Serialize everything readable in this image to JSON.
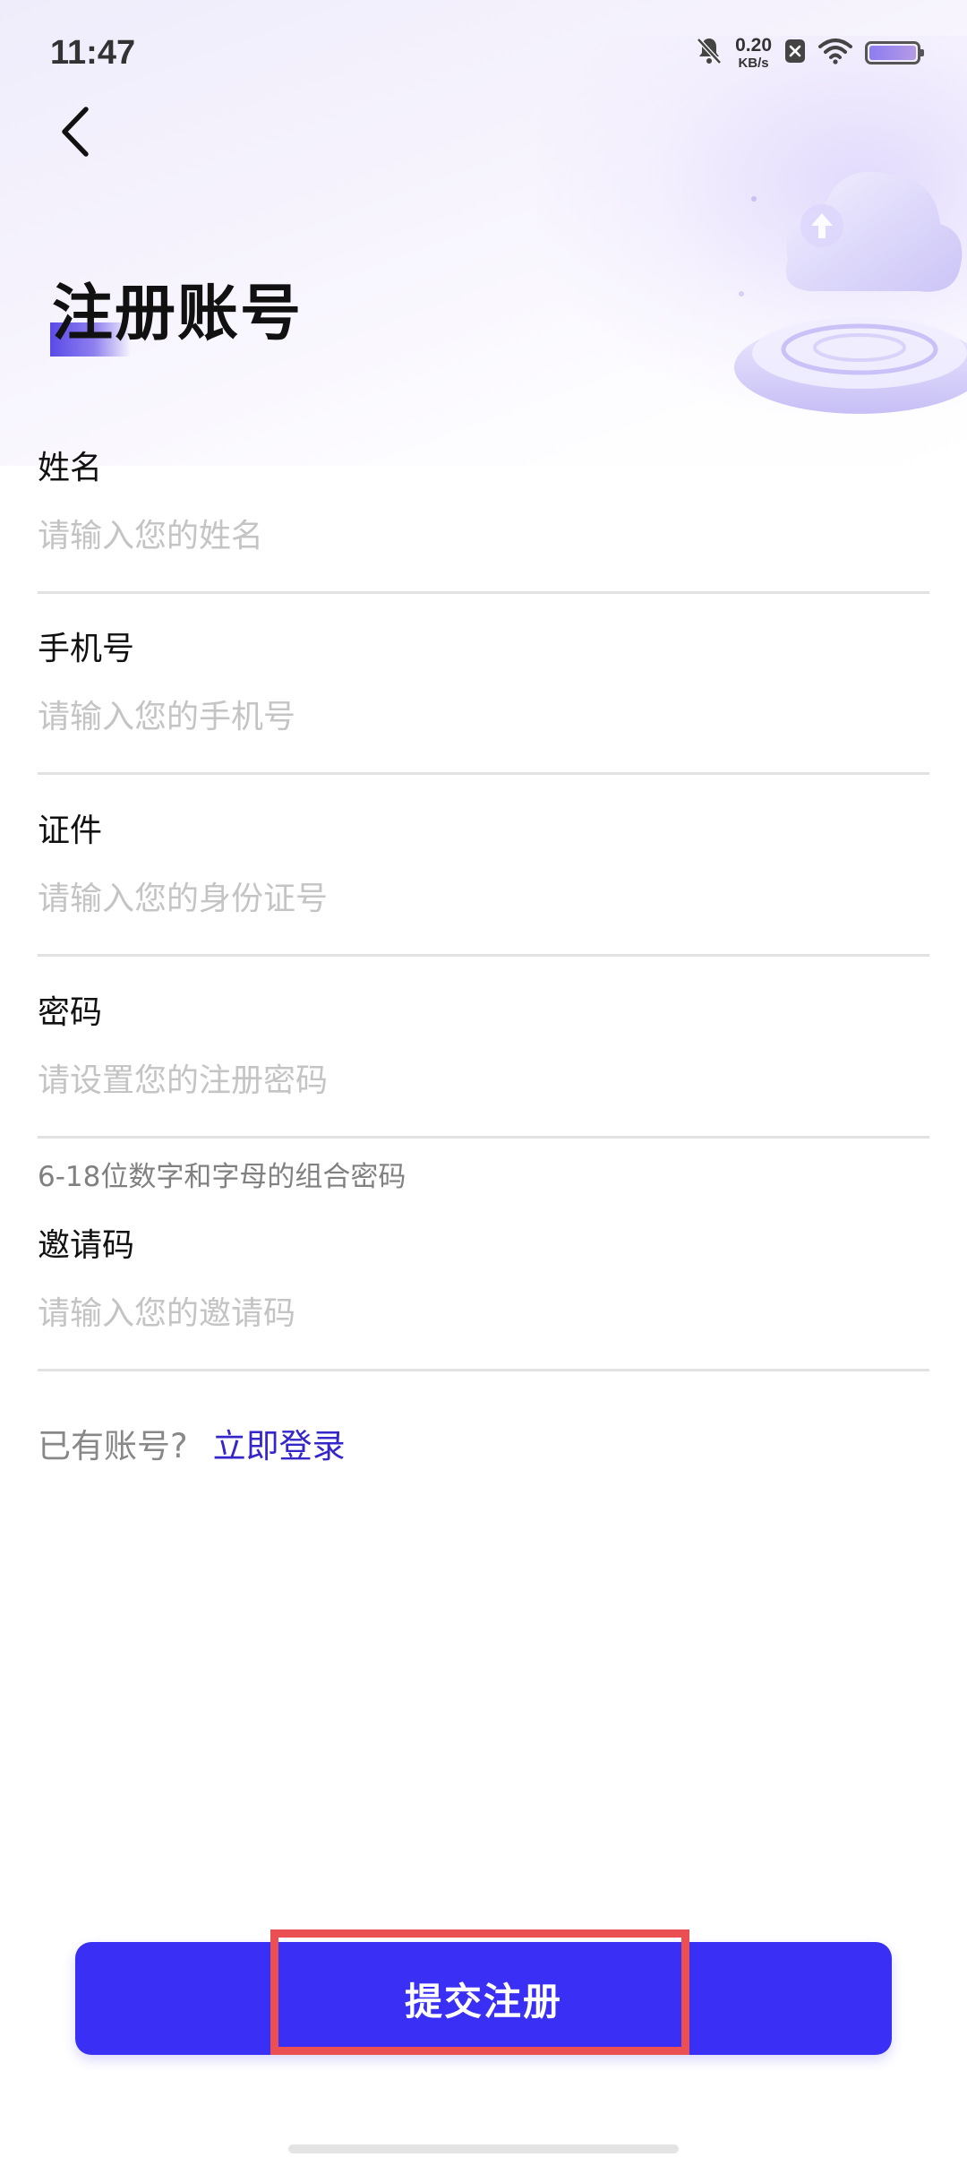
{
  "status_bar": {
    "time": "11:47",
    "net_speed_value": "0.20",
    "net_speed_unit": "KB/s",
    "icons": [
      "bell-mute-icon",
      "close-box-icon",
      "wifi-icon",
      "battery-icon"
    ]
  },
  "header": {
    "back_icon": "chevron-left-icon",
    "title": "注册账号"
  },
  "form": {
    "fields": [
      {
        "label": "姓名",
        "placeholder": "请输入您的姓名",
        "value": ""
      },
      {
        "label": "手机号",
        "placeholder": "请输入您的手机号",
        "value": ""
      },
      {
        "label": "证件",
        "placeholder": "请输入您的身份证号",
        "value": ""
      },
      {
        "label": "密码",
        "placeholder": "请设置您的注册密码",
        "value": "",
        "hint": "6-18位数字和字母的组合密码"
      },
      {
        "label": "邀请码",
        "placeholder": "请输入您的邀请码",
        "value": ""
      }
    ]
  },
  "login": {
    "prefix": "已有账号?",
    "link": "立即登录"
  },
  "submit": {
    "label": "提交注册"
  },
  "colors": {
    "accent": "#3a2ff5",
    "link": "#3526c9",
    "highlight": "#ec4f53",
    "placeholder": "#c4c4c4"
  }
}
